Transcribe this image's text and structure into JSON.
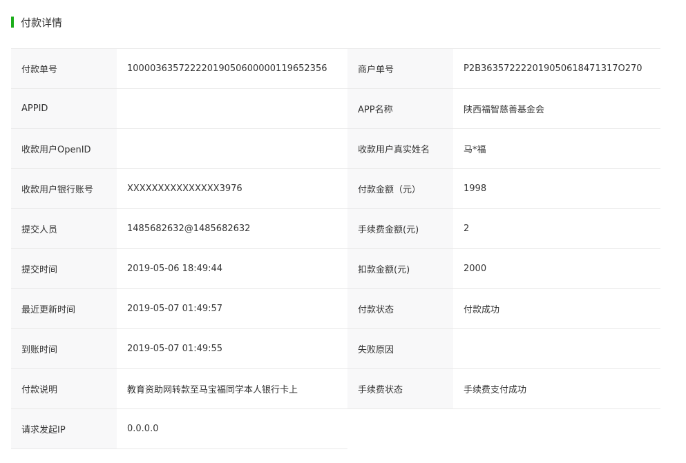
{
  "header": {
    "title": "付款详情",
    "accent_color": "#1aad19"
  },
  "rows": [
    {
      "label1": "付款单号",
      "value1": "10000363572222019050600000119652356",
      "label2": "商户单号",
      "value2": "P2B363572222019050618471317O270"
    },
    {
      "label1": "APPID",
      "value1": "",
      "label2": "APP名称",
      "value2": "陕西福智慈善基金会"
    },
    {
      "label1": "收款用户OpenID",
      "value1": "",
      "label2": "收款用户真实姓名",
      "value2": "马*福"
    },
    {
      "label1": "收款用户银行账号",
      "value1": "XXXXXXXXXXXXXXX3976",
      "label2": "付款金额（元）",
      "value2": "1998"
    },
    {
      "label1": "提交人员",
      "value1": "1485682632@1485682632",
      "label2": "手续费金额(元)",
      "value2": "2"
    },
    {
      "label1": "提交时间",
      "value1": "2019-05-06 18:49:44",
      "label2": "扣款金额(元)",
      "value2": "2000"
    },
    {
      "label1": "最近更新时间",
      "value1": "2019-05-07 01:49:57",
      "label2": "付款状态",
      "value2": "付款成功"
    },
    {
      "label1": "到账时间",
      "value1": "2019-05-07 01:49:55",
      "label2": "失败原因",
      "value2": ""
    },
    {
      "label1": "付款说明",
      "value1": "教育资助网转款至马宝福同学本人银行卡上",
      "label2": "手续费状态",
      "value2": "手续费支付成功"
    },
    {
      "label1": "请求发起IP",
      "value1": "0.0.0.0",
      "label2": "",
      "value2": ""
    }
  ]
}
